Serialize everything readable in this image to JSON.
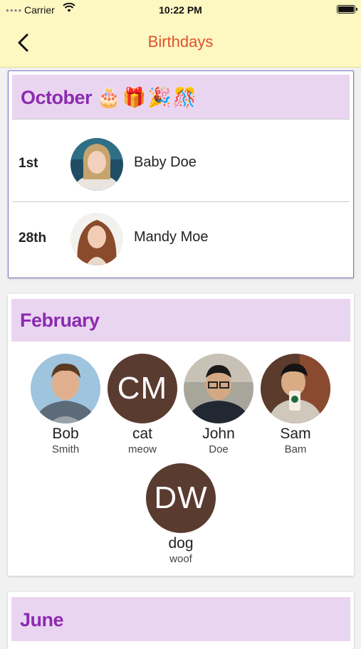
{
  "status_bar": {
    "carrier": "Carrier",
    "time": "10:22 PM"
  },
  "nav": {
    "title": "Birthdays"
  },
  "october": {
    "month": "October",
    "emoji": "🎂🎁🎉🎊",
    "rows": [
      {
        "day": "1st",
        "name": "Baby Doe"
      },
      {
        "day": "28th",
        "name": "Mandy Moe"
      }
    ]
  },
  "february": {
    "month": "February",
    "people": [
      {
        "first": "Bob",
        "last": "Smith"
      },
      {
        "first": "cat",
        "last": "meow",
        "initials": "CM"
      },
      {
        "first": "John",
        "last": "Doe"
      },
      {
        "first": "Sam",
        "last": "Bam"
      },
      {
        "first": "dog",
        "last": "woof",
        "initials": "DW"
      }
    ]
  },
  "june": {
    "month": "June"
  },
  "colors": {
    "bar": "#fdf7c2",
    "title": "#e0522a",
    "month": "#8b2bb0",
    "header_bg": "#ead5f1",
    "initials_bg": "#5a3b30"
  }
}
